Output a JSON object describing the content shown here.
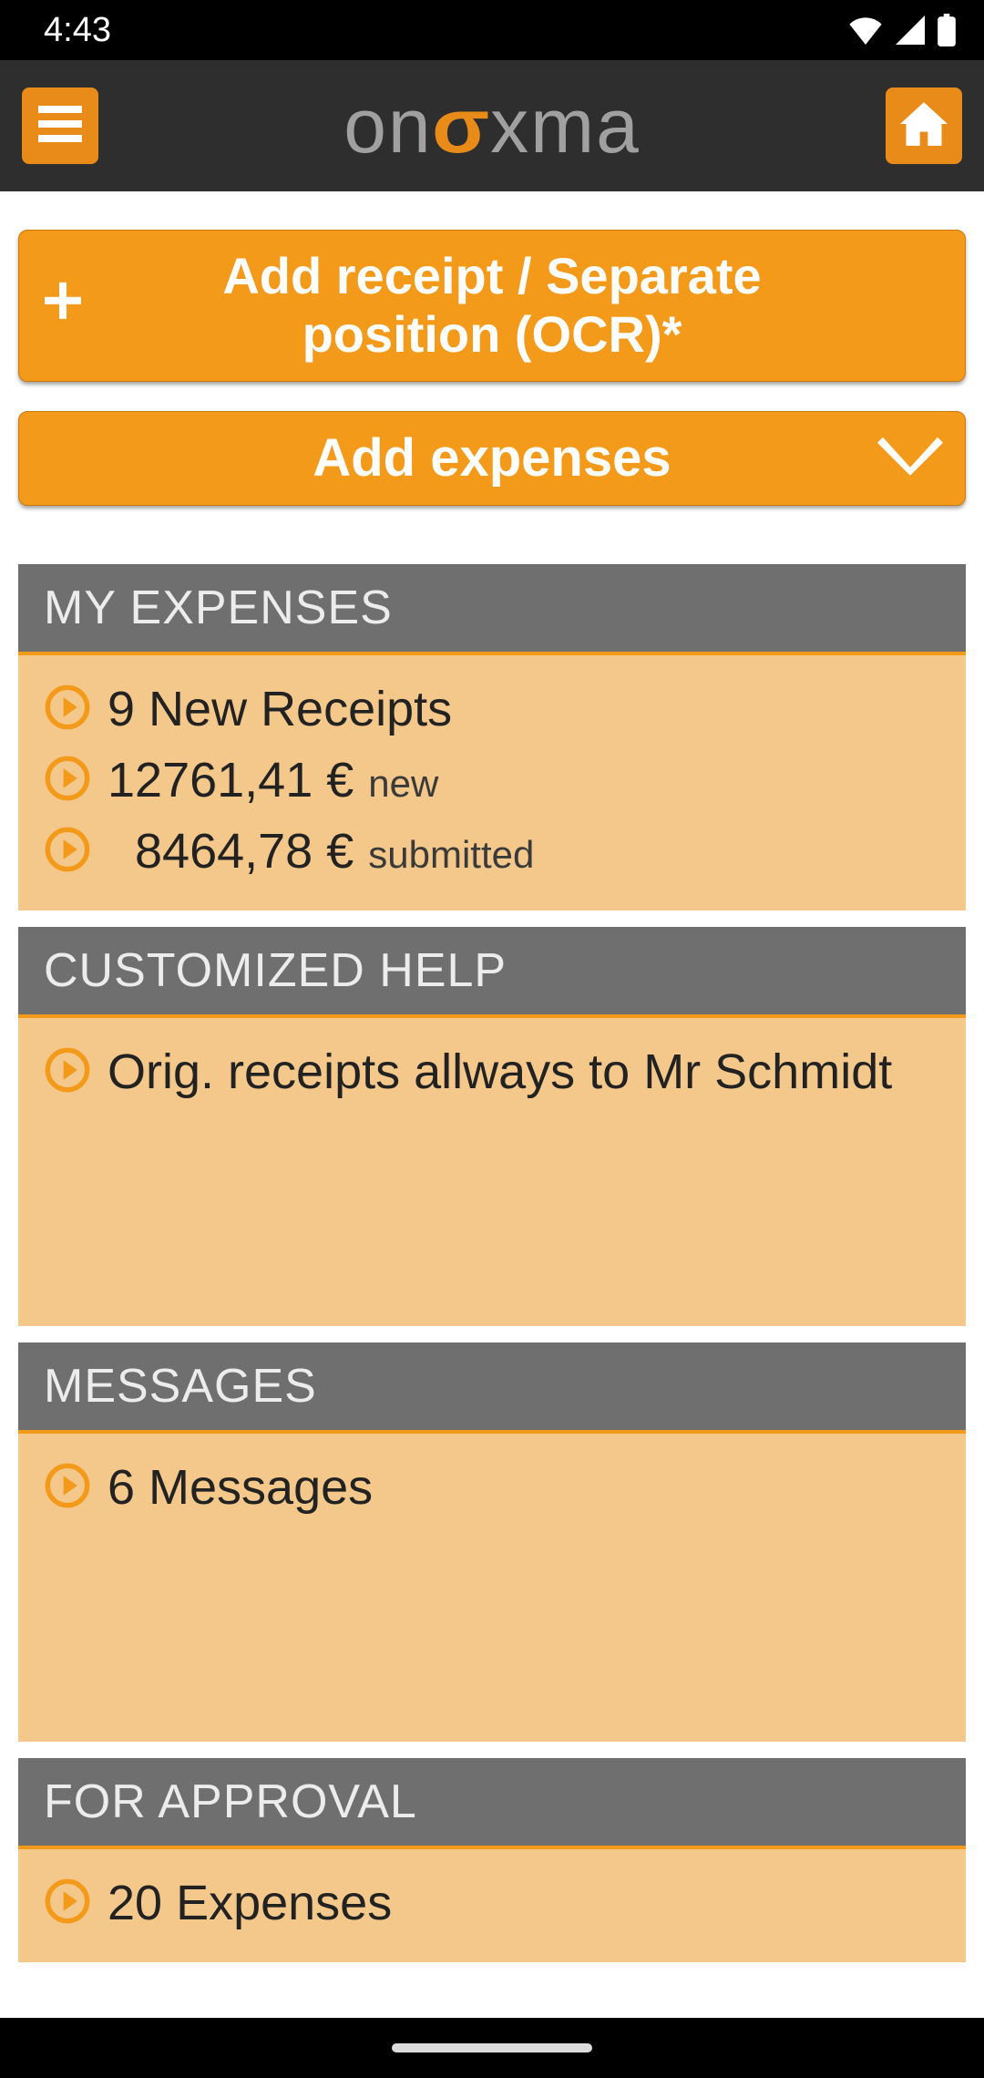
{
  "status": {
    "time": "4:43"
  },
  "logo": {
    "pre": "on",
    "sigma": "Σ",
    "post": "xma"
  },
  "buttons": {
    "add_receipt": "Add receipt / Separate position (OCR)*",
    "add_expenses": "Add expenses"
  },
  "sections": {
    "my_expenses": {
      "title": "MY EXPENSES",
      "rows": {
        "r1": "9 New Receipts",
        "r2_amount": "12761,41 €",
        "r2_sub": "new",
        "r3_amount": "  8464,78 €",
        "r3_sub": "submitted"
      }
    },
    "help": {
      "title": "CUSTOMIZED HELP",
      "row": "Orig. receipts allways to Mr Schmidt"
    },
    "messages": {
      "title": "MESSAGES",
      "row": "6 Messages"
    },
    "approval": {
      "title": "FOR APPROVAL",
      "row": "20 Expenses"
    }
  }
}
